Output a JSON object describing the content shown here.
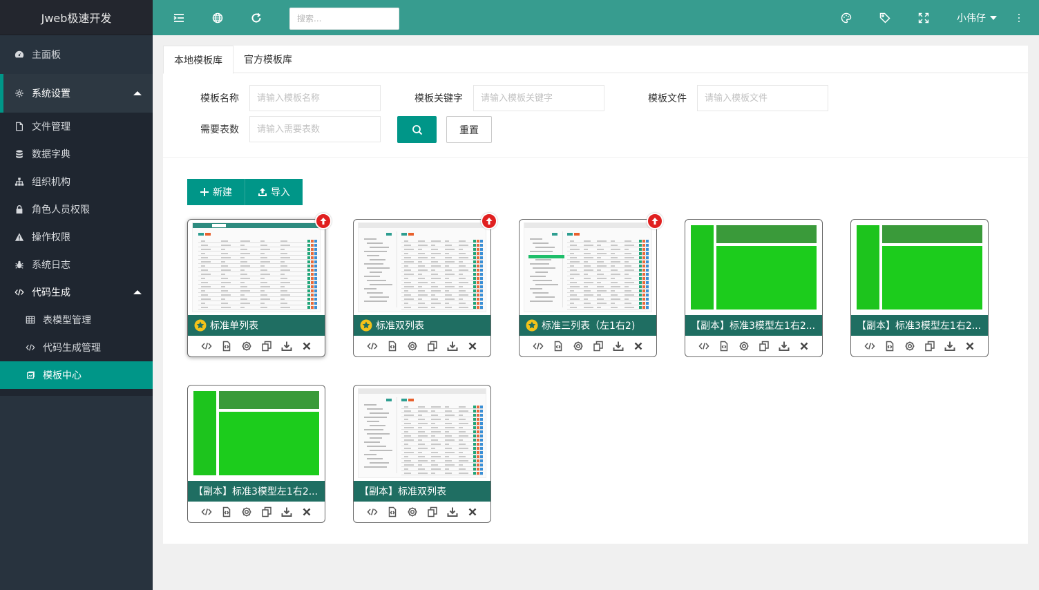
{
  "app": {
    "title": "Jweb极速开发",
    "user": "小伟仔"
  },
  "search": {
    "placeholder": "搜索..."
  },
  "sidebar": {
    "items": [
      {
        "label": "主面板",
        "icon": "dashboard-icon"
      },
      {
        "label": "系统设置",
        "icon": "gear-icon"
      },
      {
        "label": "文件管理",
        "icon": "file-icon"
      },
      {
        "label": "数据字典",
        "icon": "database-icon"
      },
      {
        "label": "组织机构",
        "icon": "sitemap-icon"
      },
      {
        "label": "角色人员权限",
        "icon": "lock-icon"
      },
      {
        "label": "操作权限",
        "icon": "warning-icon"
      },
      {
        "label": "系统日志",
        "icon": "bug-icon"
      },
      {
        "label": "代码生成",
        "icon": "code-icon"
      },
      {
        "label": "表模型管理",
        "icon": "table-icon"
      },
      {
        "label": "代码生成管理",
        "icon": "code-icon"
      },
      {
        "label": "模板中心",
        "icon": "template-icon"
      }
    ]
  },
  "tabs": [
    "本地模板库",
    "官方模板库"
  ],
  "form": {
    "name_label": "模板名称",
    "name_placeholder": "请输入模板名称",
    "keyword_label": "模板关键字",
    "keyword_placeholder": "请输入模板关键字",
    "file_label": "模板文件",
    "file_placeholder": "请输入模板文件",
    "tables_label": "需要表数",
    "tables_placeholder": "请输入需要表数",
    "reset_label": "重置"
  },
  "toolbar": {
    "new_label": "新建",
    "import_label": "导入"
  },
  "cards": [
    {
      "title": "标准单列表",
      "official": true,
      "thumb": "single-list"
    },
    {
      "title": "标准双列表",
      "official": true,
      "thumb": "double-list"
    },
    {
      "title": "标准三列表（左1右2)",
      "official": true,
      "thumb": "triple-list"
    },
    {
      "title": "【副本】标准3模型左1右2...",
      "official": false,
      "thumb": "green-layout"
    },
    {
      "title": "【副本】标准3模型左1右2...",
      "official": false,
      "thumb": "green-layout"
    },
    {
      "title": "【副本】标准3模型左1右2...",
      "official": false,
      "thumb": "green-layout"
    },
    {
      "title": "【副本】标准双列表",
      "official": false,
      "thumb": "double-list"
    }
  ],
  "colors": {
    "header": "#379c8f",
    "accent": "#009688",
    "sidebar": "#28333e",
    "caption": "#1f6e62",
    "badge": "#e02020"
  }
}
